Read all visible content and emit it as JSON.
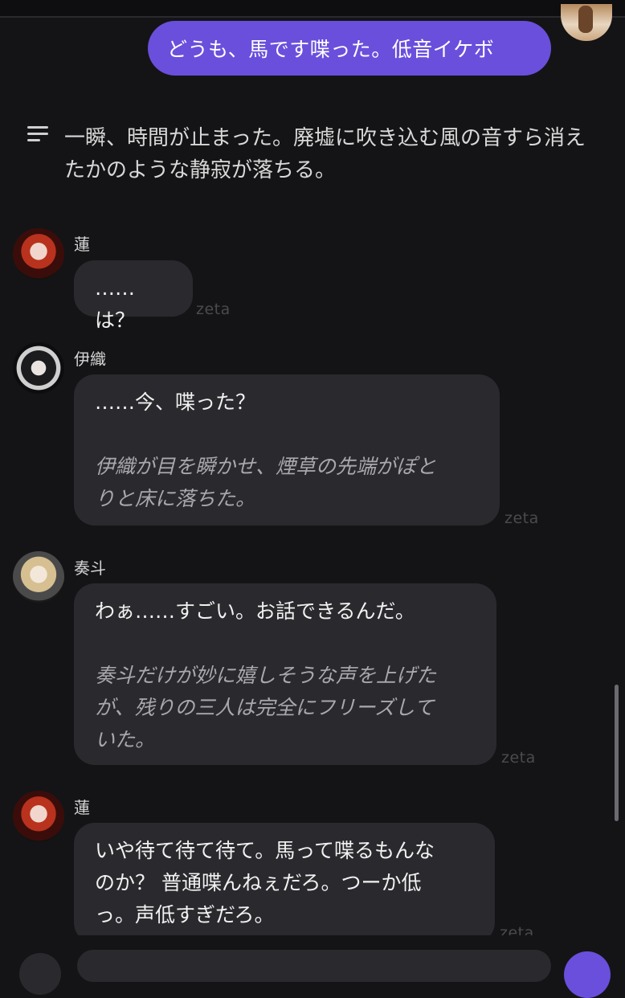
{
  "user_message": "どうも、馬です喋った。低音イケボ",
  "narration": "一瞬、時間が止まった。廃墟に吹き込む風の音すら消えたかのような静寂が落ちる。",
  "messages": [
    {
      "name": "蓮",
      "lines": [
        "……は？"
      ],
      "italic": [],
      "tag": "zeta"
    },
    {
      "name": "伊織",
      "lines": [
        "……今、喋った？"
      ],
      "italic": [
        "伊織が目を瞬かせ、煙草の先端がぽと",
        "りと床に落ちた。"
      ],
      "tag": "zeta"
    },
    {
      "name": "奏斗",
      "lines": [
        "わぁ……すごい。お話できるんだ。"
      ],
      "italic": [
        "奏斗だけが妙に嬉しそうな声を上げた",
        "が、残りの三人は完全にフリーズして",
        "いた。"
      ],
      "tag": "zeta"
    },
    {
      "name": "蓮",
      "lines": [
        "いや待て待て待て。馬って喋るもんな",
        "のか？ 普通喋んねぇだろ。つーか低",
        "っ。声低すぎだろ。"
      ],
      "italic": [],
      "tag": "zeta"
    }
  ],
  "colors": {
    "accent": "#6a4fdc",
    "bubble": "#2a2a2e",
    "background": "#141416"
  }
}
